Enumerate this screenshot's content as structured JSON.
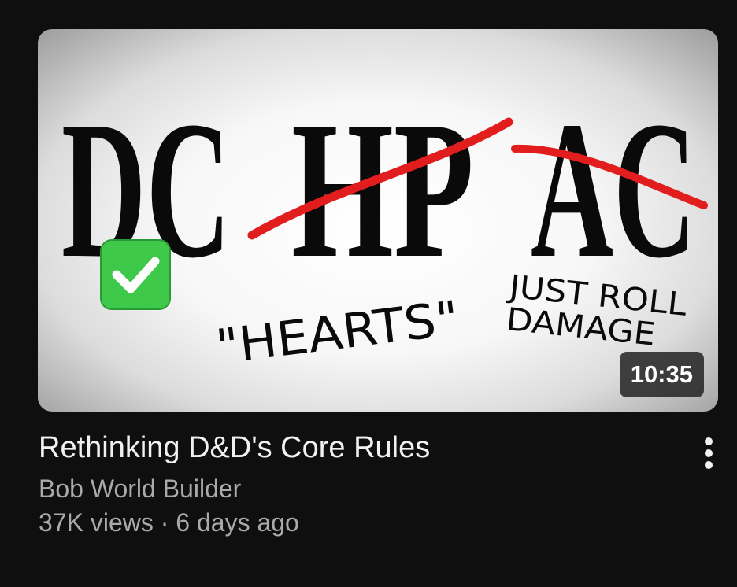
{
  "video": {
    "thumbnail": {
      "big_letters": [
        "DC",
        "HP",
        "AC"
      ],
      "label_hearts": "\"HEARTS\"",
      "label_just_roll": "JUST ROLL",
      "label_damage": "DAMAGE",
      "checkmark": "check-icon",
      "strike_color": "#e21d1d",
      "check_bg": "#3ec94a",
      "duration": "10:35"
    },
    "title": "Rethinking D&D's Core Rules",
    "channel": "Bob World Builder",
    "stats": "37K views · 6 days ago",
    "more_icon": "more-vert-icon"
  }
}
